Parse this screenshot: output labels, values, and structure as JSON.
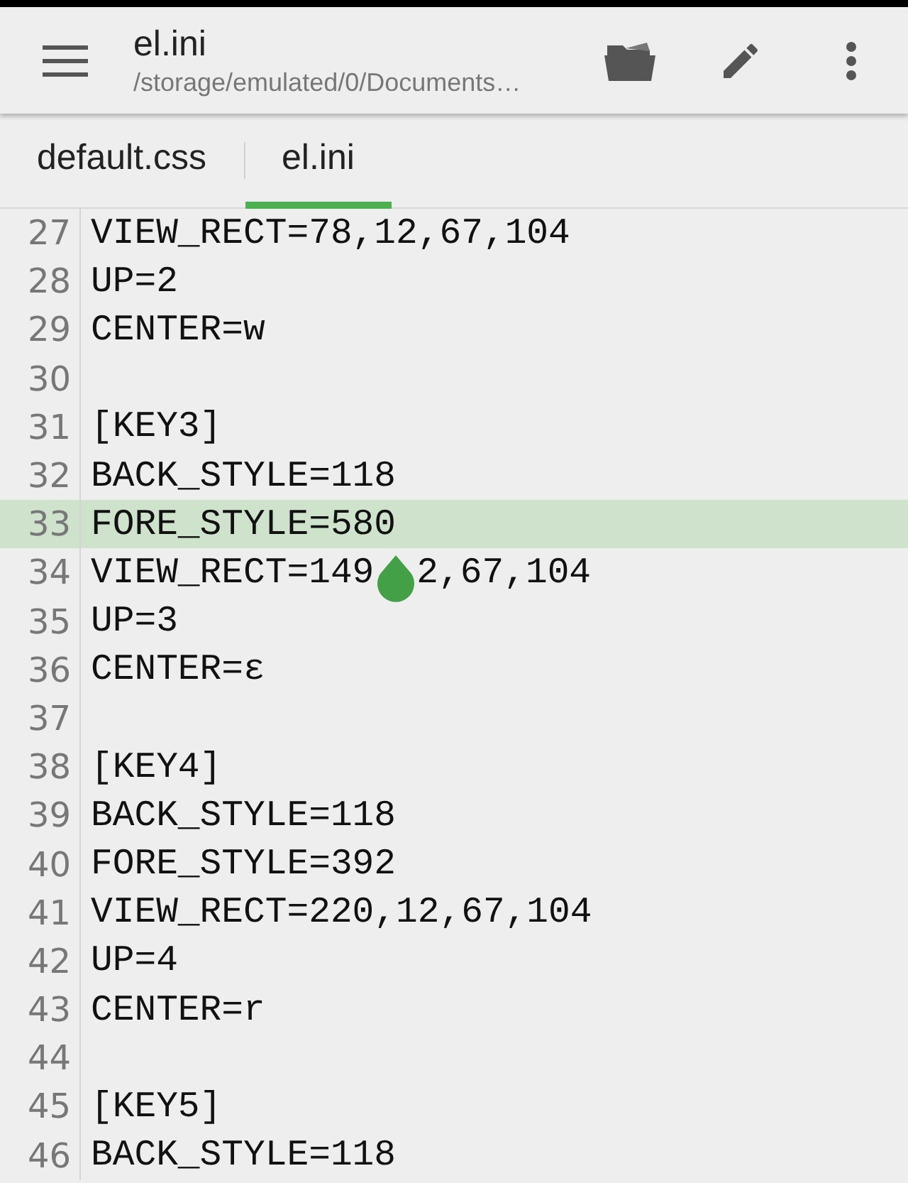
{
  "toolbar": {
    "title": "el.ini",
    "path": "/storage/emulated/0/Documents…"
  },
  "tabs": [
    {
      "label": "default.css",
      "selected": false
    },
    {
      "label": "el.ini",
      "selected": true
    }
  ],
  "lines": [
    {
      "num": "27",
      "parts": [
        "VIEW_RECT=78,12,67,104"
      ],
      "current": false
    },
    {
      "num": "28",
      "parts": [
        "UP=2"
      ],
      "current": false
    },
    {
      "num": "29",
      "parts": [
        "CENTER=w"
      ],
      "current": false
    },
    {
      "num": "30",
      "current": false
    },
    {
      "num": "31",
      "parts": [
        "[KEY3]"
      ],
      "current": false
    },
    {
      "num": "32",
      "parts": [
        "BACK_STYLE=118"
      ],
      "current": false
    },
    {
      "num": "33",
      "parts": [
        "FORE_STYLE=580"
      ],
      "current": true
    },
    {
      "num": "34",
      "parts": [
        "VIEW_RECT=149",
        "2,67,104"
      ],
      "current": false
    },
    {
      "num": "35",
      "parts": [
        "UP=3"
      ],
      "current": false
    },
    {
      "num": "36",
      "parts": [
        "CENTER=ε"
      ],
      "current": false
    },
    {
      "num": "37",
      "current": false
    },
    {
      "num": "38",
      "parts": [
        "[KEY4]"
      ],
      "current": false
    },
    {
      "num": "39",
      "parts": [
        "BACK_STYLE=118"
      ],
      "current": false
    },
    {
      "num": "40",
      "parts": [
        "FORE_STYLE=392"
      ],
      "current": false
    },
    {
      "num": "41",
      "parts": [
        "VIEW_RECT=220,12,67,104"
      ],
      "current": false
    },
    {
      "num": "42",
      "parts": [
        "UP=4"
      ],
      "current": false
    },
    {
      "num": "43",
      "parts": [
        "CENTER=r"
      ],
      "current": false
    },
    {
      "num": "44",
      "current": false
    },
    {
      "num": "45",
      "parts": [
        "[KEY5]"
      ],
      "current": false
    },
    {
      "num": "46",
      "parts": [
        "BACK_STYLE=118"
      ],
      "current": false
    }
  ]
}
